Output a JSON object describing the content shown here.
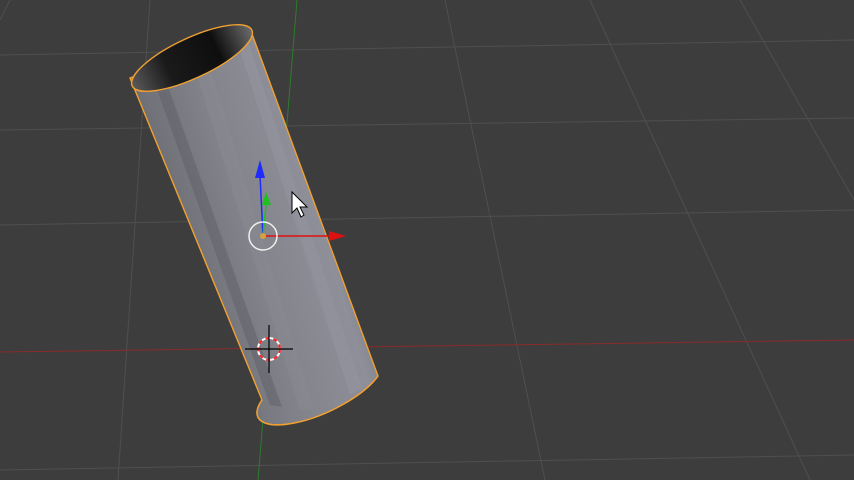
{
  "viewport": {
    "background": "#3d3d3d",
    "grid_color": "#4f4f4f",
    "x_axis_color": "#8a2a2a",
    "y_axis_color": "#2e7a2e"
  },
  "object": {
    "type": "cylinder",
    "selected": true,
    "outline_color": "#f0a030",
    "body_color": "#80818a",
    "interior_color": "#1a1a1a"
  },
  "gizmo": {
    "z_axis_color": "#1e2bff",
    "y_axis_color": "#20c020",
    "x_axis_color": "#e01010",
    "origin_ring_color": "#f0f0f0"
  },
  "cursor_3d": {
    "ring_colors": [
      "#ff2020",
      "#ffffff"
    ],
    "crosshair_color": "#000000"
  },
  "icons": {
    "pointer": "mouse-pointer-icon",
    "cursor3d": "3d-cursor-icon"
  }
}
